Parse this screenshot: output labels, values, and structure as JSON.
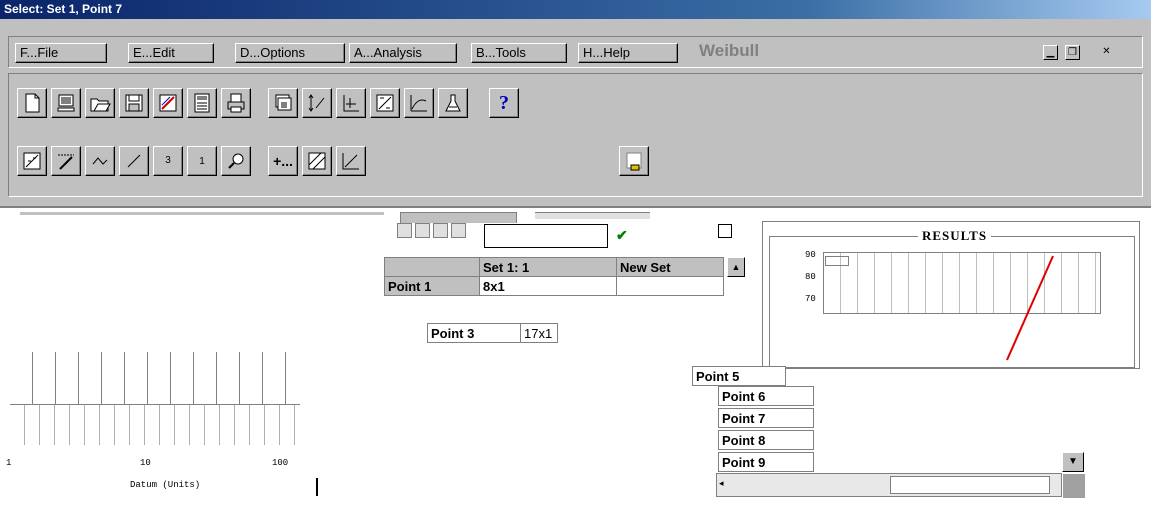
{
  "window": {
    "title": "Select: Set 1, Point  7"
  },
  "menu": {
    "items": [
      {
        "label": "F...File"
      },
      {
        "label": "E...Edit"
      },
      {
        "label": "D...Options"
      },
      {
        "label": "A...Analysis"
      },
      {
        "label": "B...Tools"
      },
      {
        "label": "H...Help"
      }
    ],
    "app_name": "Weibull"
  },
  "toolbar": {
    "row1": [
      "new-icon",
      "computer-icon",
      "open-folder-icon",
      "save-icon",
      "plot-icon",
      "calculator-icon",
      "print-icon",
      "stack-icon",
      "sort-icon",
      "chart-axes-icon",
      "fit-icon",
      "curve-icon",
      "flask-icon",
      "help-icon"
    ],
    "row2": [
      "plot-a-icon",
      "plot-b-icon",
      "plot-c-icon",
      "line-icon",
      "fraction-3-icon",
      "fraction-1-icon",
      "magnifier-icon",
      "add-icon",
      "hatch-icon",
      "area-icon",
      "end-icon"
    ],
    "help_symbol": "?",
    "frac3_text": "3",
    "frac1_text": "1",
    "add_text": "+..."
  },
  "grid": {
    "columns": [
      "Set 1: 1",
      "New Set"
    ],
    "rows": [
      {
        "name": "Point 1",
        "value": "8x1"
      }
    ],
    "partial_rows": [
      {
        "name": "Point 3",
        "value": "17x1"
      }
    ],
    "check_symbol": "✔"
  },
  "points_list": {
    "items": [
      "Point 5",
      "Point 6",
      "Point 7",
      "Point 8",
      "Point 9"
    ]
  },
  "results": {
    "title": "RESULTS",
    "y_ticks": [
      "90",
      "80",
      "70"
    ]
  },
  "lower_chart": {
    "x_ticks": [
      "1",
      "10",
      "100"
    ],
    "x_label": "Datum (Units)"
  }
}
